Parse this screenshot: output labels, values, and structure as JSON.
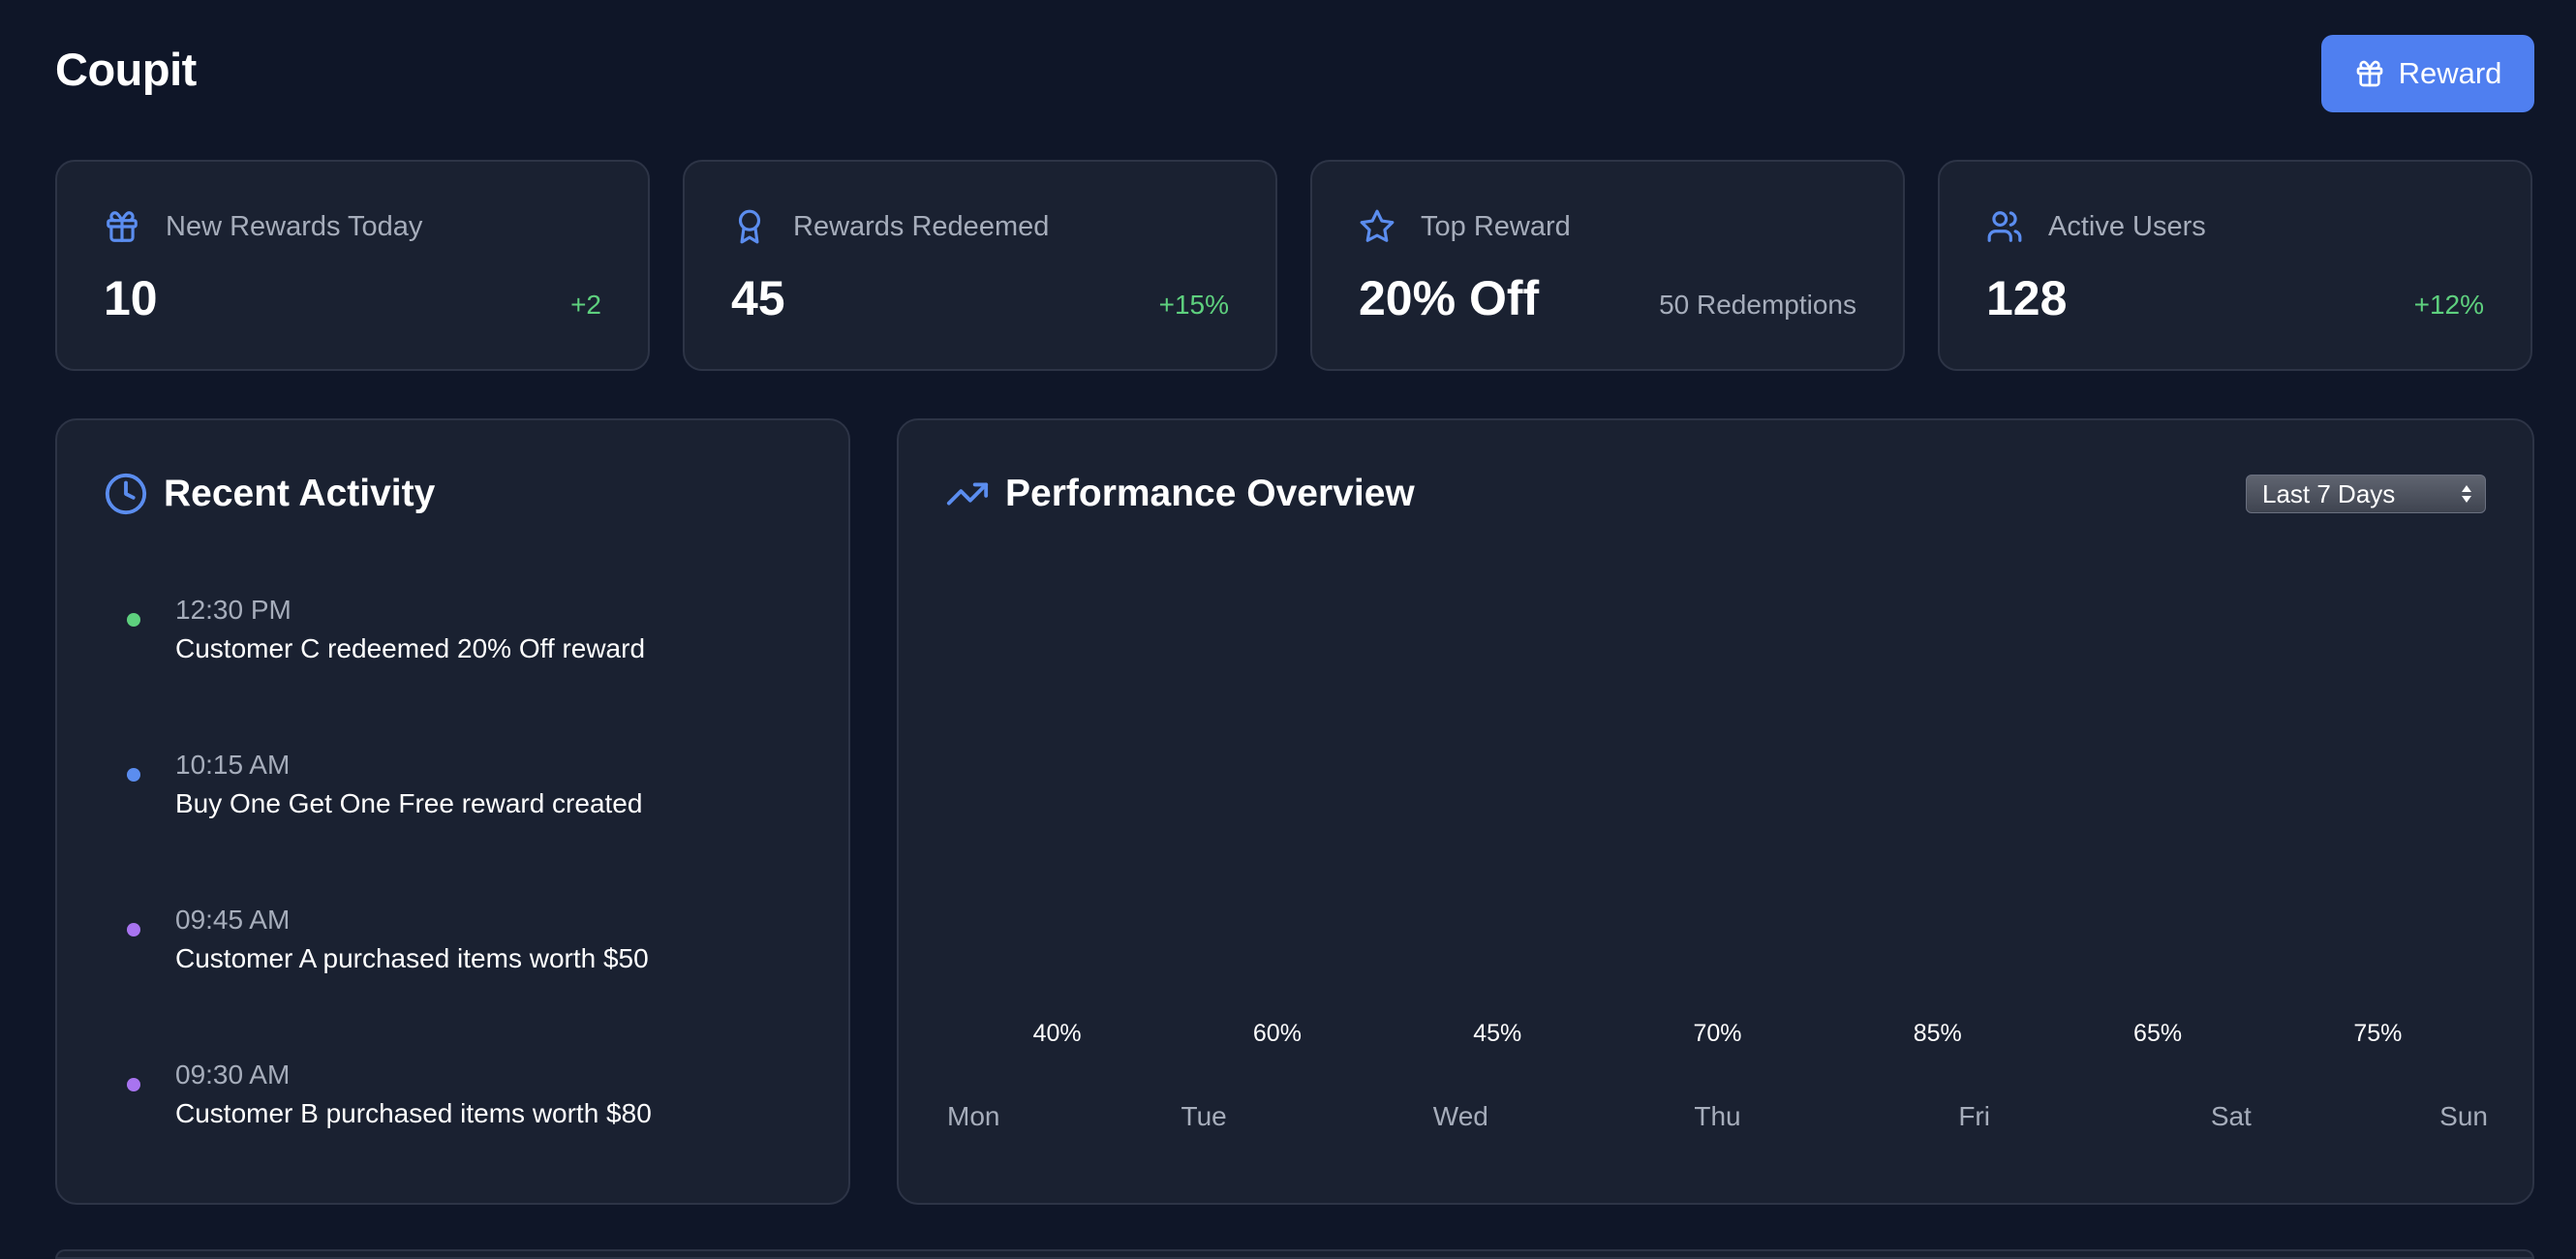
{
  "app": {
    "title": "Coupit"
  },
  "header": {
    "reward_button_label": "Reward"
  },
  "stats": [
    {
      "icon": "gift-icon",
      "label": "New Rewards Today",
      "value": "10",
      "delta": "+2"
    },
    {
      "icon": "award-icon",
      "label": "Rewards Redeemed",
      "value": "45",
      "delta": "+15%"
    },
    {
      "icon": "star-icon",
      "label": "Top Reward",
      "value": "20% Off",
      "delta": "50 Redemptions"
    },
    {
      "icon": "users-icon",
      "label": "Active Users",
      "value": "128",
      "delta": "+12%"
    }
  ],
  "activity": {
    "title": "Recent Activity",
    "icon": "clock-icon",
    "items": [
      {
        "time": "12:30 PM",
        "text": "Customer C redeemed 20% Off reward",
        "color": "#5ed07e"
      },
      {
        "time": "10:15 AM",
        "text": "Buy One Get One Free reward created",
        "color": "#5b8def"
      },
      {
        "time": "09:45 AM",
        "text": "Customer A purchased items worth $50",
        "color": "#a874f0"
      },
      {
        "time": "09:30 AM",
        "text": "Customer B purchased items worth $80",
        "color": "#a874f0"
      }
    ]
  },
  "performance": {
    "title": "Performance Overview",
    "icon": "trending-up-icon",
    "range_selected": "Last 7 Days"
  },
  "chart_data": {
    "type": "bar",
    "categories": [
      "Mon",
      "Tue",
      "Wed",
      "Thu",
      "Fri",
      "Sat",
      "Sun"
    ],
    "values": [
      40,
      60,
      45,
      70,
      85,
      65,
      75
    ],
    "value_labels": [
      "40%",
      "60%",
      "45%",
      "70%",
      "85%",
      "65%",
      "75%"
    ],
    "ylim": [
      0,
      100
    ],
    "grid": false
  },
  "colors": {
    "background": "#0f1628",
    "card": "#1a2131",
    "accent": "#4f7ff0",
    "positive": "#5ed07e"
  }
}
